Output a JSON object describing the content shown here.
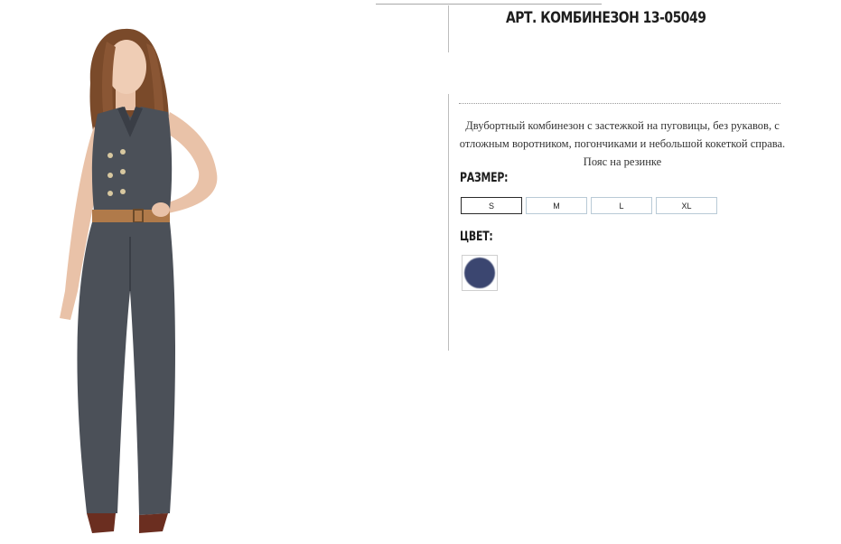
{
  "product": {
    "title": "АРТ. КОМБИНЕЗОН 13-05049",
    "description": "Двубортный комбинезон с застежкой на пуговицы, без рукавов, с отложным воротником, погончиками и небольшой кокеткой справа. Пояс на резинке",
    "size_label": "РАЗМЕР:",
    "sizes": [
      "S",
      "M",
      "L",
      "XL"
    ],
    "selected_size": "S",
    "color_label": "ЦВЕТ:",
    "colors": [
      {
        "name": "navy",
        "hex": "#3b4670"
      }
    ]
  },
  "colors": {
    "jumpsuit": "#4b5058",
    "jumpsuit_dark": "#3a3e46",
    "skin": "#e9c2a8",
    "hair": "#7a4a2a",
    "belt": "#b07a4a",
    "shoes": "#6b2e20"
  }
}
